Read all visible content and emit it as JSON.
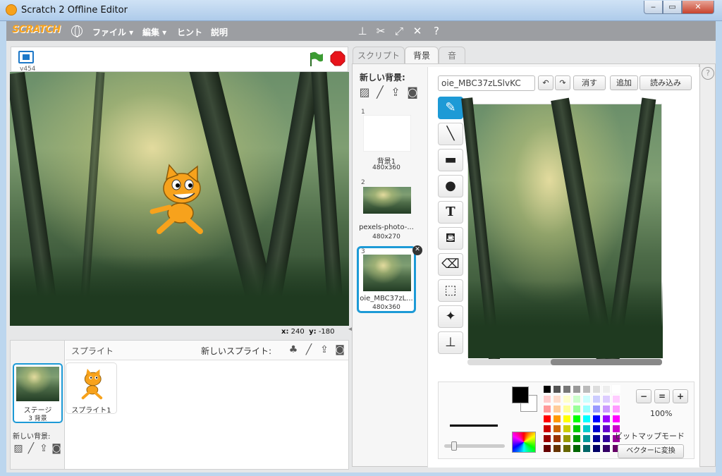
{
  "window": {
    "title": "Scratch 2 Offline Editor",
    "min": "‒",
    "max": "▭",
    "close": "✕"
  },
  "menubar": {
    "logo": "SCRATCH",
    "file": "ファイル ▾",
    "edit": "編集 ▾",
    "hint": "ヒント",
    "help": "説明"
  },
  "stage": {
    "version": "v454",
    "x_label": "x:",
    "x_value": "240",
    "y_label": "y:",
    "y_value": "-180"
  },
  "sprites_pane": {
    "title": "スプライト",
    "new_sprite": "新しいスプライト:",
    "stage_name": "ステージ",
    "stage_backdrops": "3 背景",
    "new_backdrop": "新しい背景:",
    "sprite1": "スプライト1"
  },
  "tabs": {
    "scripts": "スクリプト",
    "backdrops": "背景",
    "sounds": "音"
  },
  "backdrops_panel": {
    "new_backdrop": "新しい背景:",
    "costumes": [
      {
        "num": "1",
        "name": "背景1",
        "size": "480x360"
      },
      {
        "num": "2",
        "name": "pexels-photo-...",
        "size": "480x270"
      },
      {
        "num": "3",
        "name": "oie_MBC37zL...",
        "size": "480x360"
      }
    ]
  },
  "paint_editor": {
    "costume_name": "oie_MBC37zLSlvKC",
    "clear": "消す",
    "add": "追加",
    "import": "読み込み",
    "zoom": "100%",
    "mode": "ビットマップモード",
    "convert": "ベクターに変換"
  },
  "colors": {
    "accent": "#1d9ad6",
    "menubar": "#9c9ea2",
    "stop": "#e8141b",
    "flag": "#3c9b33"
  }
}
